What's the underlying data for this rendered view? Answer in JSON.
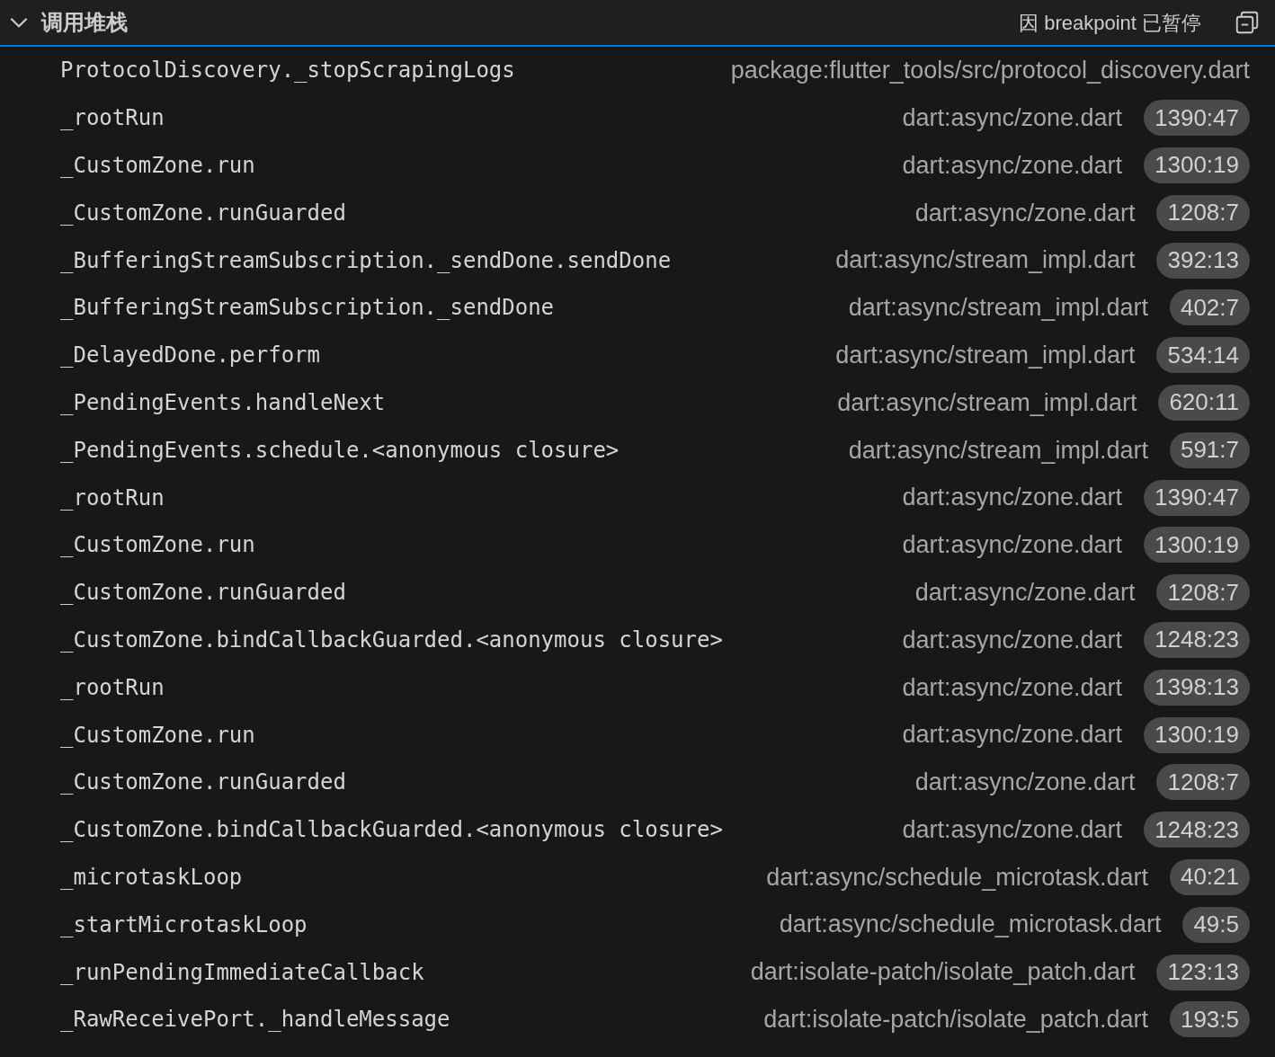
{
  "header": {
    "title": "调用堆栈",
    "status": "因 breakpoint 已暂停",
    "expanded": true
  },
  "frames": [
    {
      "function": "ProtocolDiscovery._stopScrapingLogs",
      "source": "package:flutter_tools/src/protocol_discovery.dart"
    },
    {
      "function": "_rootRun",
      "source": "dart:async/zone.dart",
      "position": "1390:47"
    },
    {
      "function": "_CustomZone.run",
      "source": "dart:async/zone.dart",
      "position": "1300:19"
    },
    {
      "function": "_CustomZone.runGuarded",
      "source": "dart:async/zone.dart",
      "position": "1208:7"
    },
    {
      "function": "_BufferingStreamSubscription._sendDone.sendDone",
      "source": "dart:async/stream_impl.dart",
      "position": "392:13"
    },
    {
      "function": "_BufferingStreamSubscription._sendDone",
      "source": "dart:async/stream_impl.dart",
      "position": "402:7"
    },
    {
      "function": "_DelayedDone.perform",
      "source": "dart:async/stream_impl.dart",
      "position": "534:14"
    },
    {
      "function": "_PendingEvents.handleNext",
      "source": "dart:async/stream_impl.dart",
      "position": "620:11"
    },
    {
      "function": "_PendingEvents.schedule.<anonymous closure>",
      "source": "dart:async/stream_impl.dart",
      "position": "591:7"
    },
    {
      "function": "_rootRun",
      "source": "dart:async/zone.dart",
      "position": "1390:47"
    },
    {
      "function": "_CustomZone.run",
      "source": "dart:async/zone.dart",
      "position": "1300:19"
    },
    {
      "function": "_CustomZone.runGuarded",
      "source": "dart:async/zone.dart",
      "position": "1208:7"
    },
    {
      "function": "_CustomZone.bindCallbackGuarded.<anonymous closure>",
      "source": "dart:async/zone.dart",
      "position": "1248:23"
    },
    {
      "function": "_rootRun",
      "source": "dart:async/zone.dart",
      "position": "1398:13"
    },
    {
      "function": "_CustomZone.run",
      "source": "dart:async/zone.dart",
      "position": "1300:19"
    },
    {
      "function": "_CustomZone.runGuarded",
      "source": "dart:async/zone.dart",
      "position": "1208:7"
    },
    {
      "function": "_CustomZone.bindCallbackGuarded.<anonymous closure>",
      "source": "dart:async/zone.dart",
      "position": "1248:23"
    },
    {
      "function": "_microtaskLoop",
      "source": "dart:async/schedule_microtask.dart",
      "position": "40:21"
    },
    {
      "function": "_startMicrotaskLoop",
      "source": "dart:async/schedule_microtask.dart",
      "position": "49:5"
    },
    {
      "function": "_runPendingImmediateCallback",
      "source": "dart:isolate-patch/isolate_patch.dart",
      "position": "123:13"
    },
    {
      "function": "_RawReceivePort._handleMessage",
      "source": "dart:isolate-patch/isolate_patch.dart",
      "position": "193:5"
    }
  ]
}
